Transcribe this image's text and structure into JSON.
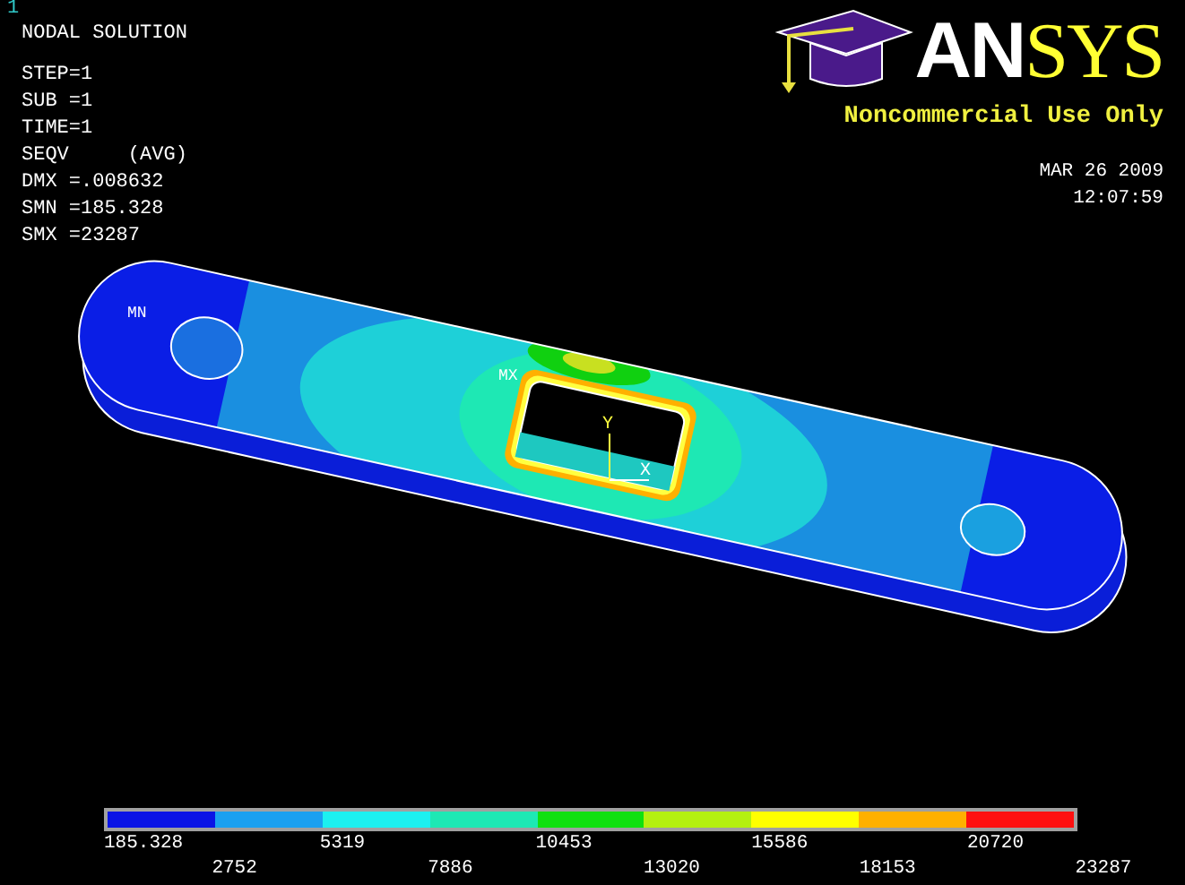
{
  "window_number": "1",
  "title": "NODAL SOLUTION",
  "info_lines": [
    "STEP=1",
    "SUB =1",
    "TIME=1",
    "SEQV     (AVG)",
    "DMX =.008632",
    "SMN =185.328",
    "SMX =23287"
  ],
  "logo": {
    "parts": [
      {
        "text": "AN",
        "color": "#ffffff"
      },
      {
        "text": "SYS",
        "color": "#ffff33"
      }
    ],
    "license": "Noncommercial Use Only"
  },
  "date": "MAR 26 2009",
  "time": "12:07:59",
  "model_labels": {
    "min": "MN",
    "max": "MX",
    "axis_y": "Y",
    "axis_x": "X"
  },
  "legend": {
    "bands": [
      {
        "color": "#0a14e6"
      },
      {
        "color": "#1aa0f0"
      },
      {
        "color": "#1cf0f0"
      },
      {
        "color": "#1ee8b4"
      },
      {
        "color": "#10e010"
      },
      {
        "color": "#b4f010"
      },
      {
        "color": "#ffff00"
      },
      {
        "color": "#ffb000"
      },
      {
        "color": "#ff1010"
      }
    ],
    "labels": [
      "185.328",
      "2752",
      "5319",
      "7886",
      "10453",
      "13020",
      "15586",
      "18153",
      "20720",
      "23287"
    ]
  }
}
